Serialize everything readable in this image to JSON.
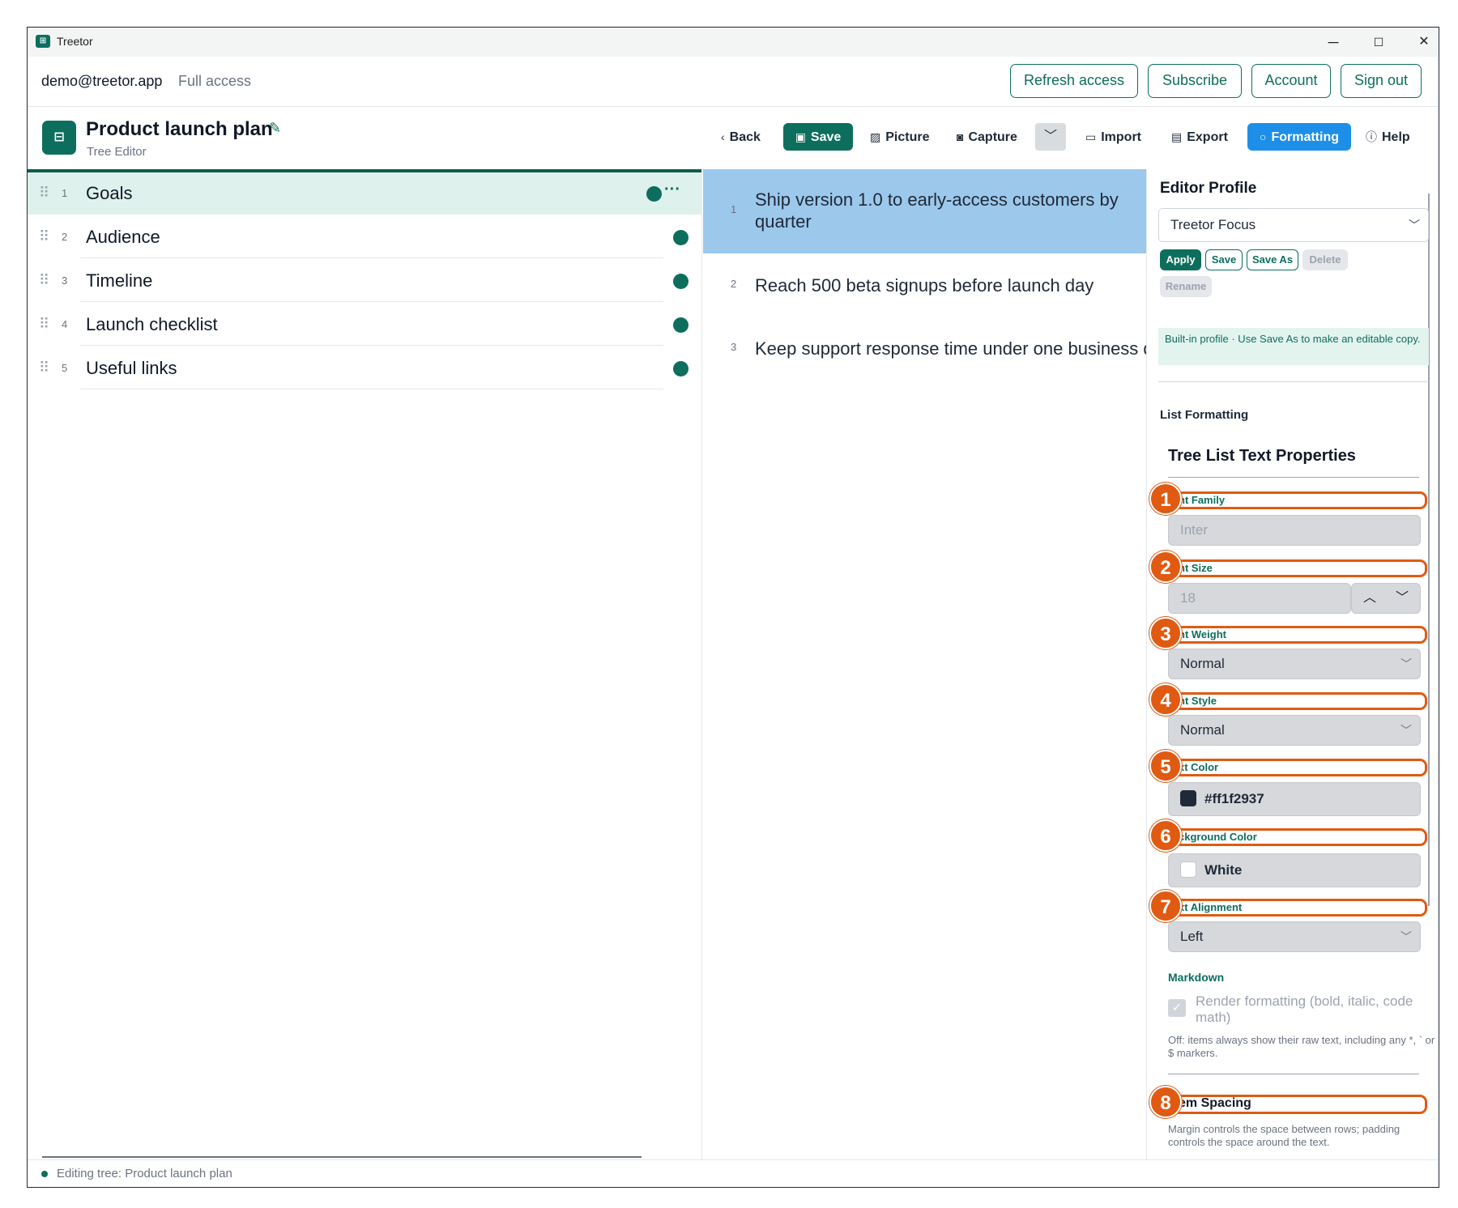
{
  "window": {
    "app_name": "Treetor",
    "minimize": "─",
    "maximize": "☐",
    "close": "✕"
  },
  "account": {
    "email": "demo@treetor.app",
    "access": "Full access",
    "buttons": [
      "Refresh access",
      "Subscribe",
      "Account",
      "Sign out"
    ]
  },
  "document": {
    "title": "Product launch plan",
    "subtitle": "Tree Editor"
  },
  "toolbar": {
    "back": "Back",
    "save": "Save",
    "picture": "Picture",
    "capture": "Capture",
    "import": "Import",
    "export": "Export",
    "formatting": "Formatting",
    "help": "Help"
  },
  "tree": {
    "items": [
      {
        "num": "1",
        "label": "Goals"
      },
      {
        "num": "2",
        "label": "Audience"
      },
      {
        "num": "3",
        "label": "Timeline"
      },
      {
        "num": "4",
        "label": "Launch checklist"
      },
      {
        "num": "5",
        "label": "Useful links"
      }
    ],
    "more": "···"
  },
  "details": {
    "items": [
      {
        "num": "1",
        "text": "Ship version 1.0 to early-access customers by quarter"
      },
      {
        "num": "2",
        "text": "Reach 500 beta signups before launch day"
      },
      {
        "num": "3",
        "text": "Keep support response time under one business day"
      }
    ]
  },
  "panel": {
    "profile_heading": "Editor Profile",
    "profile_value": "Treetor Focus",
    "profile_buttons": {
      "apply": "Apply",
      "save": "Save",
      "save_as": "Save As",
      "delete": "Delete",
      "rename": "Rename"
    },
    "note": "Built-in profile · Use Save As to make an editable copy.",
    "section_label": "List Formatting",
    "section_title": "Tree List Text Properties",
    "fields": {
      "font_family_label": "nt Family",
      "font_family_value": "Inter",
      "font_size_label": "nt Size",
      "font_size_value": "18",
      "font_weight_label": "nt Weight",
      "font_weight_value": "Normal",
      "font_style_label": "nt Style",
      "font_style_value": "Normal",
      "text_color_label": "xt Color",
      "text_color_value": "#ff1f2937",
      "background_label": "ckground Color",
      "background_value": "White",
      "alignment_label": "xt Alignment",
      "alignment_value": "Left"
    },
    "badges": [
      "1",
      "2",
      "3",
      "4",
      "5",
      "6",
      "7",
      "8"
    ],
    "markdown_label": "Markdown",
    "markdown_check": "Render formatting (bold, italic, code math)",
    "markdown_help": "Off: items always show their raw text, including any *, ` or $ markers.",
    "item_spacing_label": "em Spacing",
    "item_spacing_help": "Margin controls the space between rows; padding controls the space around the text."
  },
  "status": {
    "text": "Editing tree: Product launch plan"
  },
  "colors": {
    "brand": "#0d6e5e",
    "formatting_blue": "#1d8fe8",
    "selected_row": "#dff1ec",
    "selected_detail": "#9cc8ec",
    "annotation_orange": "#e05a12",
    "text_swatch": "#1f2937"
  }
}
